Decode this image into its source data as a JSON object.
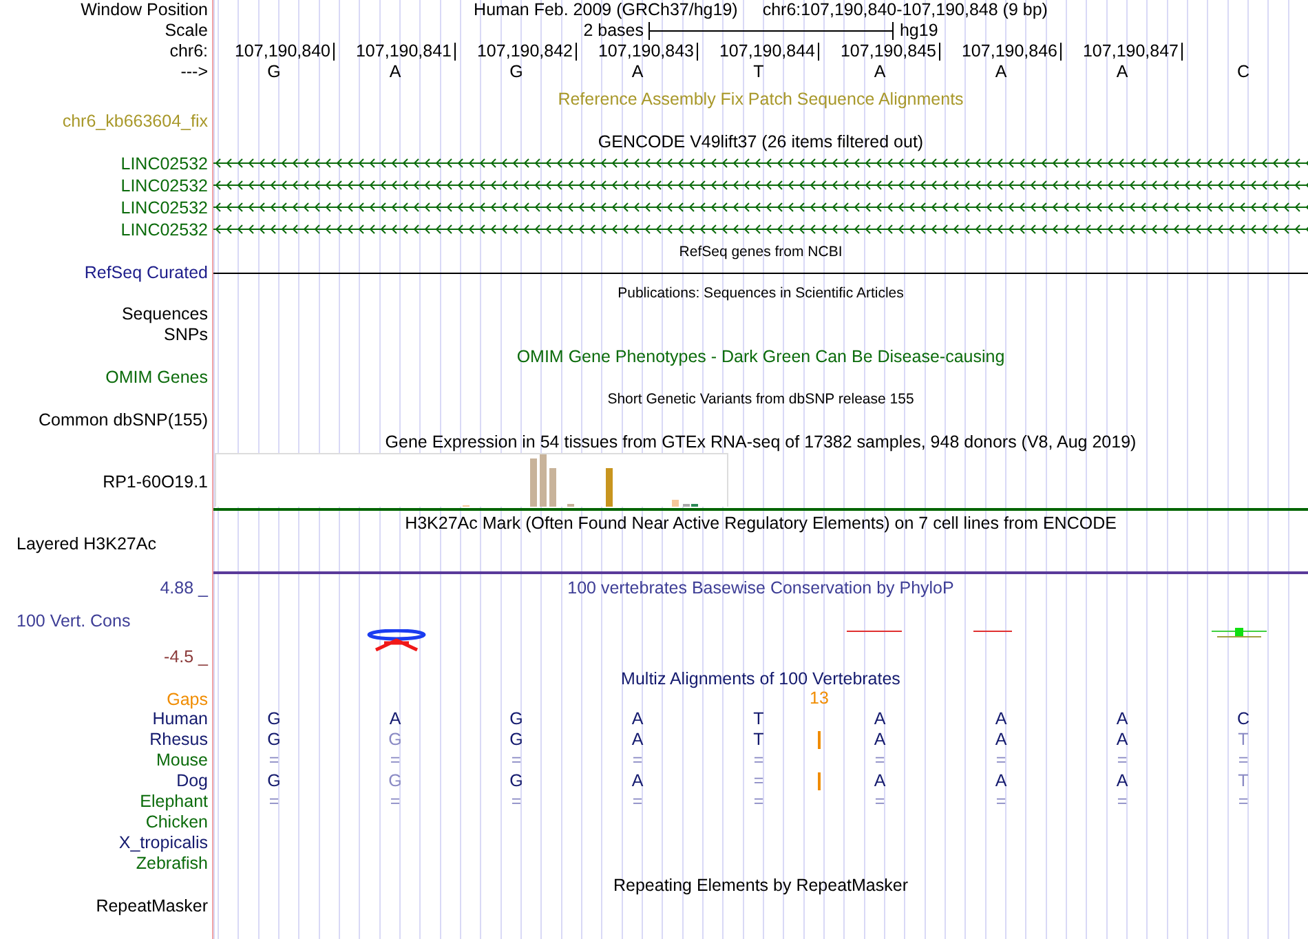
{
  "header": {
    "label": "Window Position",
    "assembly": "Human Feb. 2009 (GRCh37/hg19)",
    "position": "chr6:107,190,840-107,190,848 (9 bp)"
  },
  "scale": {
    "label": "Scale",
    "length": "2 bases",
    "assembly": "hg19"
  },
  "ruler": {
    "label": "chr6:",
    "positions": [
      "107,190,840",
      "107,190,841",
      "107,190,842",
      "107,190,843",
      "107,190,844",
      "107,190,845",
      "107,190,846",
      "107,190,847"
    ]
  },
  "sequence": {
    "label": "--->",
    "bases": [
      "G",
      "A",
      "G",
      "A",
      "T",
      "A",
      "A",
      "A",
      "C"
    ]
  },
  "tracks": [
    {
      "kind": "bar",
      "title": {
        "text": "Reference Assembly Fix Patch Sequence Alignments",
        "color": "#a8982a",
        "small": false
      },
      "labels": [
        {
          "text": "chr6_kb663604_fix",
          "color": "#a8982a"
        }
      ]
    },
    {
      "kind": "genes",
      "title": {
        "text": "GENCODE V49lift37 (26 items filtered out)",
        "color": "#000000",
        "small": false
      },
      "labels": [
        {
          "text": "LINC02532",
          "color": "#0b6b0b"
        },
        {
          "text": "LINC02532",
          "color": "#0b6b0b"
        },
        {
          "text": "LINC02532",
          "color": "#0b6b0b"
        },
        {
          "text": "LINC02532",
          "color": "#0b6b0b"
        }
      ]
    },
    {
      "kind": "line",
      "title": {
        "text": "RefSeq genes from NCBI",
        "color": "#000000",
        "small": true
      },
      "labels": [
        {
          "text": "RefSeq Curated",
          "color": "#1c1c8a"
        }
      ]
    },
    {
      "kind": "labels",
      "title": {
        "text": "Publications: Sequences in Scientific Articles",
        "color": "#000000",
        "small": true
      },
      "labels": [
        {
          "text": "Sequences",
          "color": "#000000"
        },
        {
          "text": "SNPs",
          "color": "#000000"
        }
      ]
    },
    {
      "kind": "labels",
      "title": {
        "text": "OMIM Gene Phenotypes - Dark Green Can Be Disease-causing",
        "color": "#0b6b0b",
        "small": false
      },
      "labels": [
        {
          "text": "OMIM Genes",
          "color": "#0b6b0b"
        }
      ]
    },
    {
      "kind": "labels",
      "title": {
        "text": "Short Genetic Variants from dbSNP release 155",
        "color": "#000000",
        "small": true
      },
      "labels": [
        {
          "text": "Common dbSNP(155)",
          "color": "#000000"
        }
      ]
    },
    {
      "kind": "expression",
      "title": {
        "text": "Gene Expression in 54 tissues from GTEx RNA-seq of 17382 samples, 948 donors (V8, Aug 2019)",
        "color": "#000000",
        "small": false
      },
      "labels": [
        {
          "text": "RP1-60O19.1",
          "color": "#000000"
        }
      ]
    },
    {
      "kind": "signal",
      "title": {
        "text": "H3K27Ac Mark (Often Found Near Active Regulatory Elements) on 7 cell lines from ENCODE",
        "color": "#000000",
        "small": false
      },
      "labels": [
        {
          "text": "Layered H3K27Ac",
          "color": "#000000"
        }
      ]
    },
    {
      "kind": "conservation",
      "title": {
        "text": "100 vertebrates Basewise Conservation by PhyloP",
        "color": "#3e3e96",
        "small": false
      },
      "max": {
        "text": "4.88 _",
        "color": "#3e3e96"
      },
      "labels": [
        {
          "text": "100 Vert. Cons",
          "color": "#3e3e96"
        }
      ],
      "min": {
        "text": "-4.5 _",
        "color": "#8b3a3a"
      }
    },
    {
      "kind": "alignment",
      "title": {
        "text": "Multiz Alignments of 100 Vertebrates",
        "color": "#141a6e",
        "small": false
      },
      "gaps": {
        "label": "Gaps",
        "count": "13",
        "color": "#f08c00"
      },
      "species": [
        {
          "name": "Human",
          "color": "#141a6e",
          "insertion": false,
          "bases": [
            "G",
            "A",
            "G",
            "A",
            "T",
            "A",
            "A",
            "A",
            "C"
          ],
          "faded": [
            false,
            false,
            false,
            false,
            false,
            false,
            false,
            false,
            false
          ]
        },
        {
          "name": "Rhesus",
          "color": "#141a6e",
          "insertion": true,
          "bases": [
            "G",
            "G",
            "G",
            "A",
            "T",
            "A",
            "A",
            "A",
            "T"
          ],
          "faded": [
            false,
            true,
            false,
            false,
            false,
            false,
            false,
            false,
            true
          ]
        },
        {
          "name": "Mouse",
          "color": "#0b6b0b",
          "insertion": false,
          "bases": [
            "=",
            "=",
            "=",
            "=",
            "=",
            "=",
            "=",
            "=",
            "="
          ],
          "faded": [
            true,
            true,
            true,
            true,
            true,
            true,
            true,
            true,
            true
          ]
        },
        {
          "name": "Dog",
          "color": "#141a6e",
          "insertion": true,
          "bases": [
            "G",
            "G",
            "G",
            "A",
            "=",
            "A",
            "A",
            "A",
            "T"
          ],
          "faded": [
            false,
            true,
            false,
            false,
            true,
            false,
            false,
            false,
            true
          ]
        },
        {
          "name": "Elephant",
          "color": "#0b6b0b",
          "insertion": false,
          "bases": [
            "=",
            "=",
            "=",
            "=",
            "=",
            "=",
            "=",
            "=",
            "="
          ],
          "faded": [
            true,
            true,
            true,
            true,
            true,
            true,
            true,
            true,
            true
          ]
        },
        {
          "name": "Chicken",
          "color": "#0b6b0b",
          "insertion": false
        },
        {
          "name": "X_tropicalis",
          "color": "#141a6e",
          "insertion": false
        },
        {
          "name": "Zebrafish",
          "color": "#0b6b0b",
          "insertion": false
        }
      ]
    },
    {
      "kind": "labels",
      "title": {
        "text": "Repeating Elements by RepeatMasker",
        "color": "#000000",
        "small": false
      },
      "labels": [
        {
          "text": "RepeatMasker",
          "color": "#000000"
        }
      ]
    }
  ]
}
